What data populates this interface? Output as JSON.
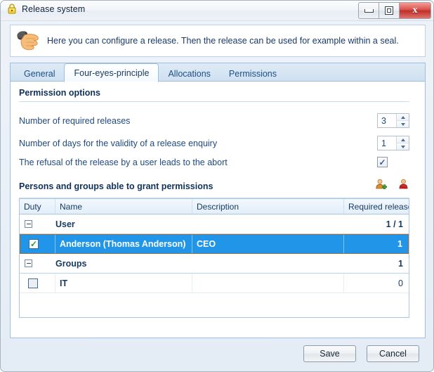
{
  "window": {
    "title": "Release system",
    "title_icon": "lock-icon",
    "controls": {
      "minimize": "minimize-icon",
      "maximize": "restore-icon",
      "close": "x"
    }
  },
  "banner": {
    "icon": "hand-pointer-icon",
    "text": "Here you can configure a release. Then the release can be used for example within a seal."
  },
  "tabs": [
    {
      "label": "General",
      "active": false
    },
    {
      "label": "Four-eyes-principle",
      "active": true
    },
    {
      "label": "Allocations",
      "active": false
    },
    {
      "label": "Permissions",
      "active": false
    }
  ],
  "permission_options": {
    "heading": "Permission options",
    "rows": [
      {
        "label": "Number of required releases",
        "value": "3",
        "control": "spinner"
      },
      {
        "label": "Number of days for the validity of a release enquiry",
        "value": "1",
        "control": "spinner"
      },
      {
        "label": "The refusal of the release by a user leads to the abort",
        "value": "✓",
        "control": "checkbox",
        "checked": true
      }
    ]
  },
  "persons_section": {
    "heading": "Persons and groups able to grant permissions",
    "actions": [
      {
        "name": "add-user-icon",
        "title": "Add"
      },
      {
        "name": "remove-user-icon",
        "title": "Remove"
      }
    ]
  },
  "grid": {
    "columns": [
      "Duty",
      "Name",
      "Description",
      "Required releases"
    ],
    "rows": [
      {
        "type": "group",
        "name": "User",
        "required": "1 / 1",
        "expanded": true
      },
      {
        "type": "data",
        "selected": true,
        "checked": true,
        "name": "Anderson (Thomas Anderson)",
        "description": "CEO",
        "required": "1"
      },
      {
        "type": "group",
        "name": "Groups",
        "required": "1",
        "expanded": true
      },
      {
        "type": "data",
        "selected": false,
        "checked": false,
        "name": "IT",
        "description": "",
        "required": "0"
      }
    ]
  },
  "footer": {
    "save_label": "Save",
    "cancel_label": "Cancel"
  },
  "colors": {
    "accent": "#2196e8",
    "selection_border": "#9a6b3b",
    "heading": "#10315c",
    "body_text": "#204a80",
    "close_button": "#bf2f29"
  }
}
